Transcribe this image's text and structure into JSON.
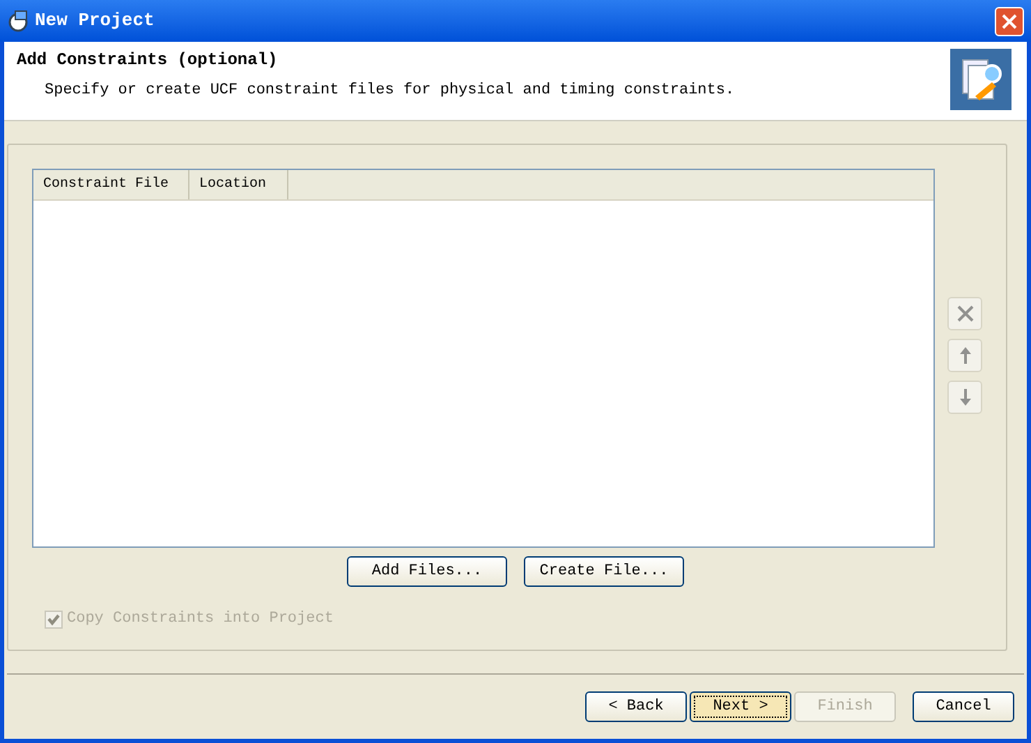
{
  "window": {
    "title": "New Project"
  },
  "header": {
    "title": "Add Constraints (optional)",
    "description": "Specify or create UCF constraint files for physical and timing constraints."
  },
  "table": {
    "columns": [
      "Constraint File",
      "Location"
    ]
  },
  "side_buttons": [
    {
      "kind": "remove",
      "disabled": true
    },
    {
      "kind": "up",
      "disabled": true
    },
    {
      "kind": "down",
      "disabled": true
    }
  ],
  "file_buttons": [
    {
      "label": "Add Files..."
    },
    {
      "label": "Create File..."
    }
  ],
  "copy_checkbox": {
    "label": "Copy Constraints into Project",
    "checked": true,
    "disabled": true
  },
  "footer_buttons": [
    {
      "label": "< Back",
      "disabled": false,
      "default": false
    },
    {
      "label": "Next >",
      "disabled": false,
      "default": true
    },
    {
      "label": "Finish",
      "disabled": true,
      "default": false
    },
    {
      "label": "Cancel",
      "disabled": false,
      "default": false
    }
  ]
}
